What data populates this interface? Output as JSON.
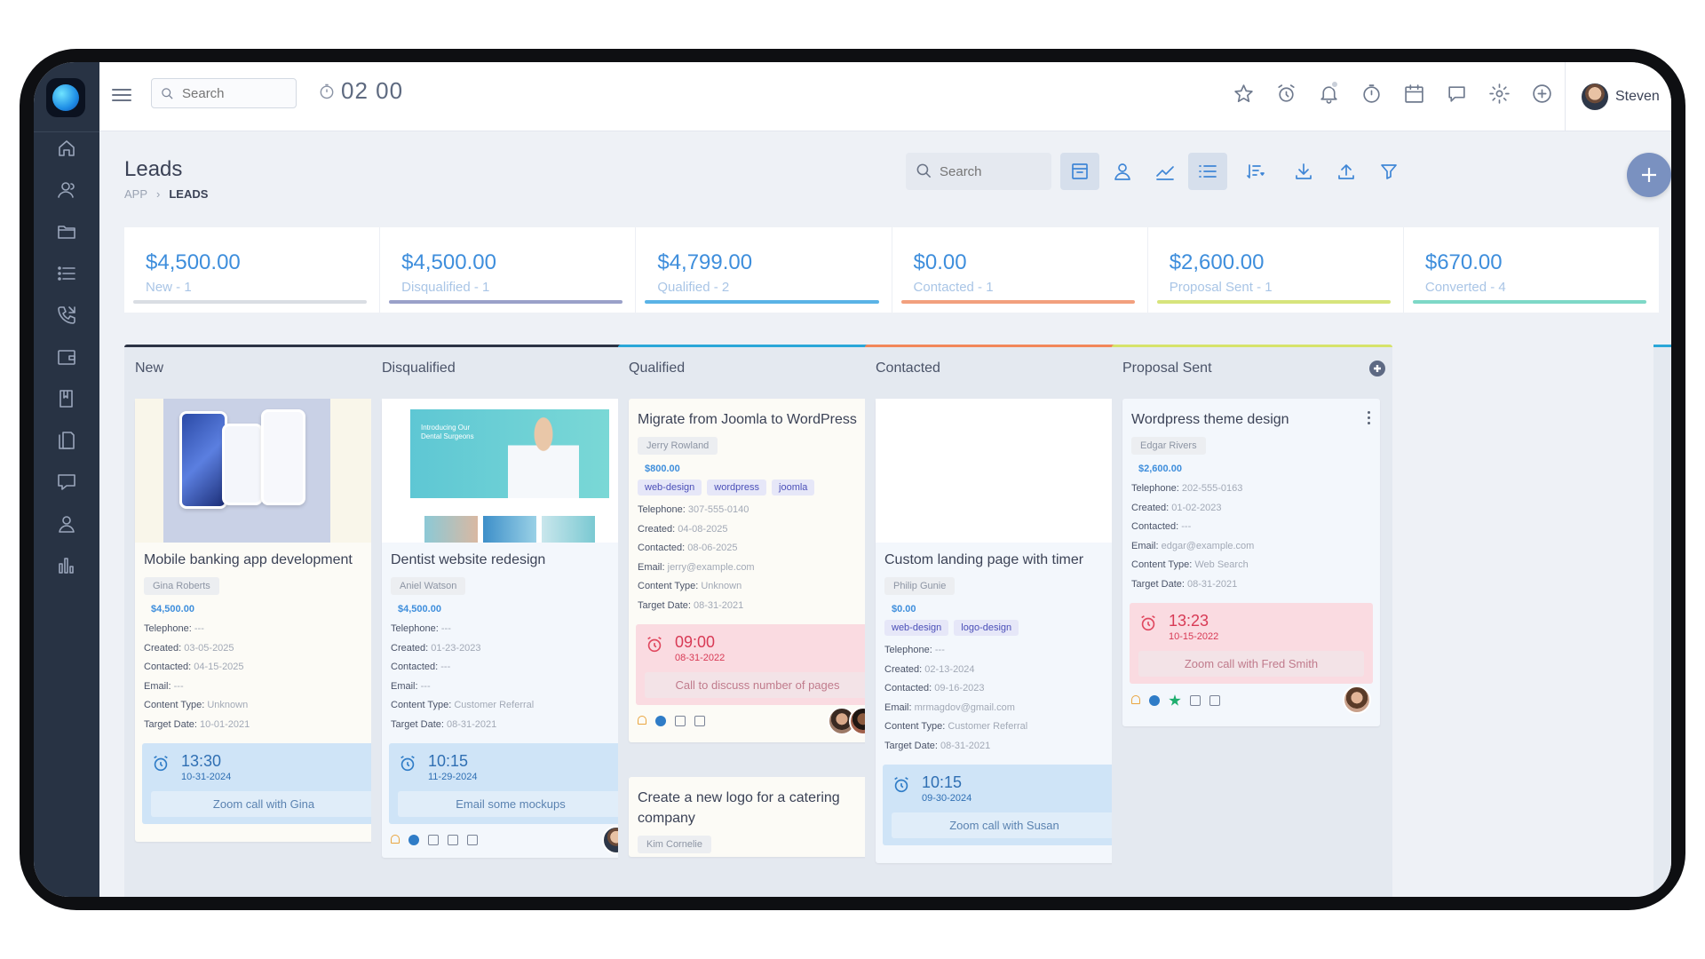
{
  "topbar": {
    "search_placeholder": "Search",
    "timer": "02 00",
    "user_name": "Steven"
  },
  "page": {
    "title": "Leads",
    "breadcrumb": [
      "APP",
      "LEADS"
    ],
    "search_placeholder": "Search"
  },
  "stats": [
    {
      "amount": "$4,500.00",
      "label": "New - 1",
      "color": "#d9dde3"
    },
    {
      "amount": "$4,500.00",
      "label": "Disqualified - 1",
      "color": "#9aa1c9"
    },
    {
      "amount": "$4,799.00",
      "label": "Qualified - 2",
      "color": "#5ab3e6"
    },
    {
      "amount": "$0.00",
      "label": "Contacted - 1",
      "color": "#f2a07e"
    },
    {
      "amount": "$2,600.00",
      "label": "Proposal Sent - 1",
      "color": "#d7e47c"
    },
    {
      "amount": "$670.00",
      "label": "Converted - 4",
      "color": "#7ed8c7"
    }
  ],
  "columns": [
    {
      "name": "New",
      "color": "#2b3344",
      "cards": [
        {
          "title": "Mobile banking app development",
          "person": "Gina Roberts",
          "amount": "$4,500.00",
          "telephone": "---",
          "created": "03-05-2025",
          "contacted": "04-15-2025",
          "email": "---",
          "content_type": "Unknown",
          "target_date": "10-01-2021",
          "reminder": {
            "time": "13:30",
            "date": "10-31-2024",
            "note": "Zoom call with Gina"
          }
        }
      ]
    },
    {
      "name": "Disqualified",
      "color": "#2b3344",
      "cards": [
        {
          "title": "Dentist website redesign",
          "person": "Aniel Watson",
          "amount": "$4,500.00",
          "telephone": "---",
          "created": "01-23-2023",
          "contacted": "---",
          "email": "---",
          "content_type": "Customer Referral",
          "target_date": "08-31-2021",
          "reminder": {
            "time": "10:15",
            "date": "11-29-2024",
            "note": "Email some mockups"
          },
          "image_text": "Introducing Our Dental Surgeons"
        }
      ]
    },
    {
      "name": "Qualified",
      "color": "#2aa7d8",
      "cards": [
        {
          "title": "Migrate from Joomla to WordPress",
          "person": "Jerry Rowland",
          "amount": "$800.00",
          "tags": [
            "web-design",
            "wordpress",
            "joomla"
          ],
          "telephone": "307-555-0140",
          "created": "04-08-2025",
          "contacted": "08-06-2025",
          "email": "jerry@example.com",
          "content_type": "Unknown",
          "target_date": "08-31-2021",
          "reminder": {
            "time": "09:00",
            "date": "08-31-2022",
            "note": "Call to discuss number of pages"
          }
        },
        {
          "title": "Create a new logo for a catering company",
          "person": "Kim Cornelie"
        }
      ]
    },
    {
      "name": "Contacted",
      "color": "#f2875a",
      "cards": [
        {
          "title": "Custom landing page with timer",
          "person": "Philip Gunie",
          "amount": "$0.00",
          "tags": [
            "web-design",
            "logo-design"
          ],
          "telephone": "---",
          "created": "02-13-2024",
          "contacted": "09-16-2023",
          "email": "mrmagdov@gmail.com",
          "content_type": "Customer Referral",
          "target_date": "08-31-2021",
          "reminder": {
            "time": "10:15",
            "date": "09-30-2024",
            "note": "Zoom call with Susan"
          }
        }
      ]
    },
    {
      "name": "Proposal Sent",
      "color": "#d6e36a",
      "cards": [
        {
          "title": "Wordpress theme design",
          "person": "Edgar Rivers",
          "amount": "$2,600.00",
          "telephone": "202-555-0163",
          "created": "01-02-2023",
          "contacted": "---",
          "email": "edgar@example.com",
          "content_type": "Web Search",
          "target_date": "08-31-2021",
          "reminder": {
            "time": "13:23",
            "date": "10-15-2022",
            "note": "Zoom call with Fred Smith"
          }
        }
      ]
    }
  ],
  "labels": {
    "telephone": "Telephone:",
    "created": "Created:",
    "contacted": "Contacted:",
    "email": "Email:",
    "content_type": "Content Type:",
    "target_date": "Target Date:"
  }
}
